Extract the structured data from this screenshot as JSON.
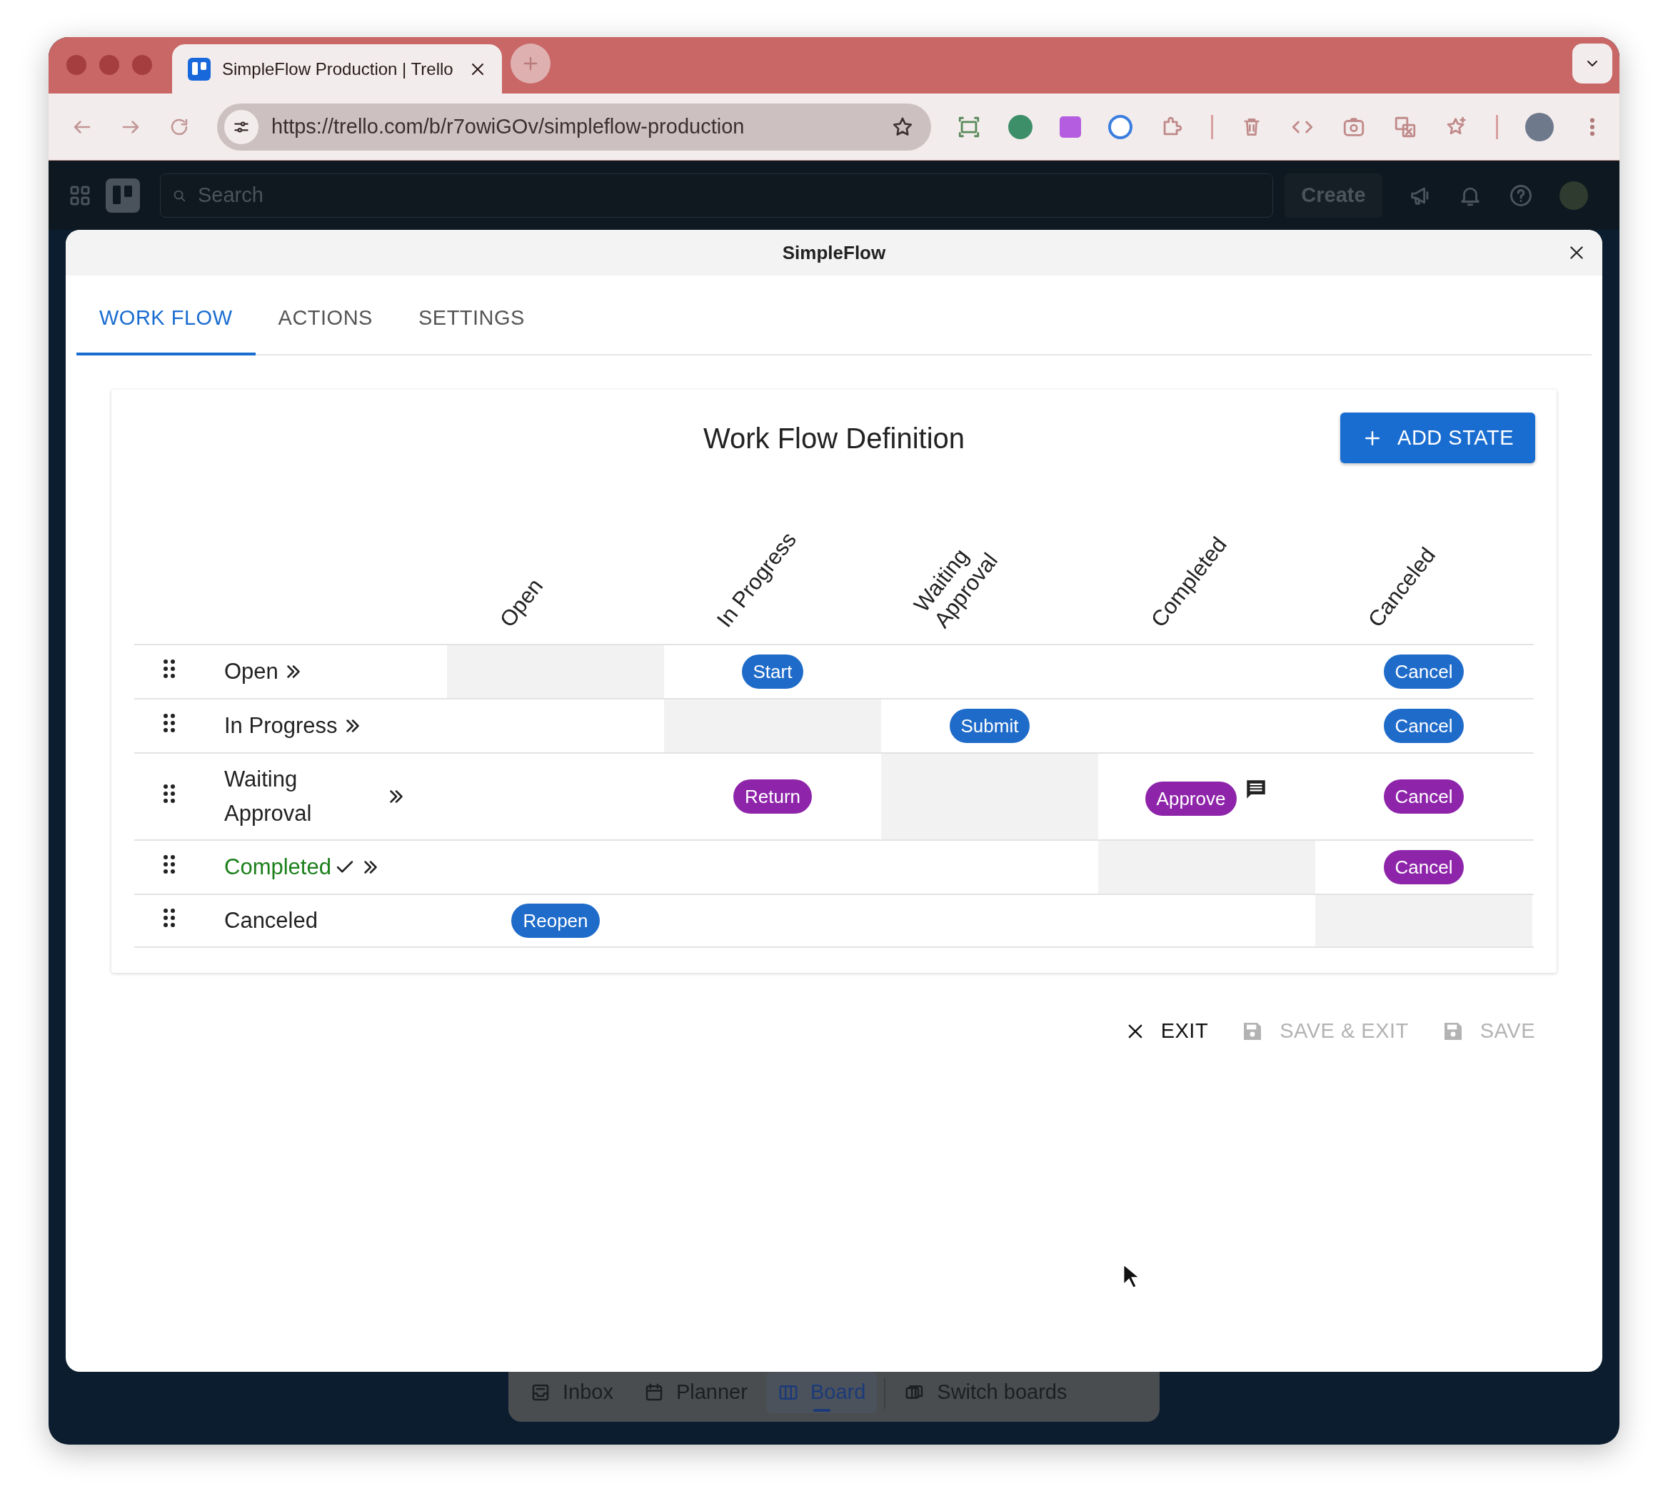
{
  "browser": {
    "tab_title": "SimpleFlow Production | Trello",
    "url": "https://trello.com/b/r7owiGOv/simpleflow-production"
  },
  "header": {
    "search_placeholder": "Search",
    "create": "Create"
  },
  "modal": {
    "title": "SimpleFlow",
    "tabs": [
      {
        "label": "WORK FLOW",
        "selected": true
      },
      {
        "label": "ACTIONS",
        "selected": false
      },
      {
        "label": "SETTINGS",
        "selected": false
      }
    ]
  },
  "card": {
    "title": "Work Flow Definition",
    "add_button": "ADD STATE"
  },
  "columns": [
    "Open",
    "In Progress",
    "Waiting Approval",
    "Completed",
    "Canceled"
  ],
  "rows": [
    {
      "label": "Open",
      "done": false,
      "forward": true,
      "cells": [
        {
          "kind": "self"
        },
        {
          "kind": "action",
          "label": "Start",
          "color": "#1e6bc9",
          "comment": false
        },
        {
          "kind": "empty"
        },
        {
          "kind": "empty"
        },
        {
          "kind": "action",
          "label": "Cancel",
          "color": "#1e6bc9",
          "comment": false
        }
      ]
    },
    {
      "label": "In Progress",
      "done": false,
      "forward": true,
      "cells": [
        {
          "kind": "empty"
        },
        {
          "kind": "self"
        },
        {
          "kind": "action",
          "label": "Submit",
          "color": "#1e6bc9",
          "comment": false
        },
        {
          "kind": "empty"
        },
        {
          "kind": "action",
          "label": "Cancel",
          "color": "#1e6bc9",
          "comment": false
        }
      ]
    },
    {
      "label": "Waiting Approval",
      "done": false,
      "forward": true,
      "cells": [
        {
          "kind": "empty"
        },
        {
          "kind": "action",
          "label": "Return",
          "color": "#8e24aa",
          "comment": false
        },
        {
          "kind": "self"
        },
        {
          "kind": "action",
          "label": "Approve",
          "color": "#8e24aa",
          "comment": true
        },
        {
          "kind": "action",
          "label": "Cancel",
          "color": "#8e24aa",
          "comment": false
        }
      ]
    },
    {
      "label": "Completed",
      "done": true,
      "forward": true,
      "cells": [
        {
          "kind": "empty"
        },
        {
          "kind": "empty"
        },
        {
          "kind": "empty"
        },
        {
          "kind": "self"
        },
        {
          "kind": "action",
          "label": "Cancel",
          "color": "#8e24aa",
          "comment": false
        }
      ]
    },
    {
      "label": "Canceled",
      "done": false,
      "forward": false,
      "cells": [
        {
          "kind": "action",
          "label": "Reopen",
          "color": "#1e6bc9",
          "comment": false
        },
        {
          "kind": "empty"
        },
        {
          "kind": "empty"
        },
        {
          "kind": "empty"
        },
        {
          "kind": "self"
        }
      ]
    }
  ],
  "footer": [
    {
      "label": "EXIT",
      "kind": "exit",
      "disabled": false
    },
    {
      "label": "SAVE & EXIT",
      "kind": "save",
      "disabled": true
    },
    {
      "label": "SAVE",
      "kind": "save",
      "disabled": true
    }
  ],
  "bottom_nav": [
    {
      "label": "Inbox",
      "kind": "inbox",
      "selected": false
    },
    {
      "label": "Planner",
      "kind": "planner",
      "selected": false
    },
    {
      "label": "Board",
      "kind": "board",
      "selected": true
    },
    {
      "label": "Switch boards",
      "kind": "switch",
      "selected": false
    }
  ]
}
